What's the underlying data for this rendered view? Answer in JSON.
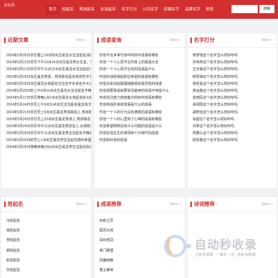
{
  "header": {
    "logo": "起名网",
    "nav": [
      "首页",
      "姓起名",
      "男孩起名",
      "女孩起名",
      "名字打分",
      "公司名字",
      "店铺名字",
      "品牌名字",
      "颜色"
    ],
    "search_placeholder": "",
    "search_button": "搜索"
  },
  "panels": {
    "articles": {
      "title": "近期文章",
      "more": "More »",
      "items": [
        "2024年5月25日农历腊上19点的出生属龙女宝宝起名消息...",
        "2024年5月21日农历下午13点14点出生属龙男女生名，男孩取名...",
        "2024年5月21日农历中午11点12点出生属龙女宝宝起名字精美...",
        "2024年5月25日出生属龙男孩，男孩取名起名有讲究字怎么...",
        "2024年5月25日出生属龙女孩起名宝宝名字女孩名字大全...",
        "2024年5月25日的上午9点10点出生属龙女宝宝起名字精美...",
        "2024年5月17日农历傍晚1点2点出生属龙女孩起名的大概方...",
        "2024年5月24日农历上午9点10点出生宝宝起名属龙有文化的...",
        "2024年5月21日农历早上9点出生属龙男孩取名儿 男孩取名...",
        "2024年5月24日农历早上23点出生属龙男孩儿 男孩取名有起...",
        "2024年5月24日农历中午11点出生属龙男孩名儿 女孩取名...",
        "2024年5月25日农历中午11点出生属龙男宝宝起名字精美...",
        "2024年5月25日的早上1点出生属龙男宝宝起名顺利幸福...",
        "2024年5月25日傍晚夜晚3点4点出生属龙男宝宝起名取名正不..."
      ]
    },
    "query": {
      "title": "成语查询",
      "more": "More »",
      "items": [
        "形容不在世事竹扇中的四字成语有哪些",
        "形容一个人心思不在你身上的成语大全",
        "形容一个人心思不在焉的成语是什么",
        "形容好话经得起耐住考验的成语有哪些",
        "形容关系前赵联姻城路很会很漂亮的成语",
        "形容需要事成就要讲清楚用的成语不用是什么",
        "形容别注意力高度集中的四字成语有哪些",
        "形容高强的贪欲成语是什么的成语",
        "形容一个人的行为没有满意的成语有哪些",
        "形容一个人的心里到了心神的成语有哪些",
        "形容希望明明没有什么问题的成语是什么",
        "形容好加生生的事情到十分惊吓的成语",
        "形容和红色的成语"
      ]
    },
    "score": {
      "title": "名字打分",
      "more": "More »",
      "items": [
        "蒋梦瑶这个名字怎么样好听吗",
        "孙伟林这个名字怎么样好听吗",
        "王天霖这个名字怎么样好听吗",
        "柳思锦这个名字怎么样好听吗",
        "吴宏嘉这个名字怎么样好听吗",
        "吴运鑫这个名字怎么样好听吗",
        "曾唐民这个名字怎么样好听吗",
        "易邱阳这个名字怎么样好听吗",
        "胡修廷这个名字怎么样好听吗",
        "肖超这个名字怎么样好听吗",
        "刘亭这个名字怎么样好听吗",
        "周雅沁这个名字怎么样好听吗",
        "廖凯雅这个名字怎么样好听吗"
      ]
    },
    "surname": {
      "title": "姓起名",
      "more": "More »",
      "items": [
        "冯姓起名",
        "钱姓起名",
        "李姓起名",
        "郝姓起名",
        "赵姓起名",
        "孙姓起名"
      ]
    },
    "idiom_rec": {
      "title": "成语推荐",
      "more": "More »",
      "items": [
        "标新立异",
        "匿而大观",
        "百岭桂冠",
        "掌门顺理",
        "风魔雨散",
        "香尘蒂荷"
      ]
    },
    "poem_rec": {
      "title": "诗词推荐",
      "more": "More »",
      "items": []
    }
  },
  "watermark": {
    "text": "自动秒收录",
    "sub": "上线 秒收录 · 一来访 一次 · 自动 秒收录"
  }
}
